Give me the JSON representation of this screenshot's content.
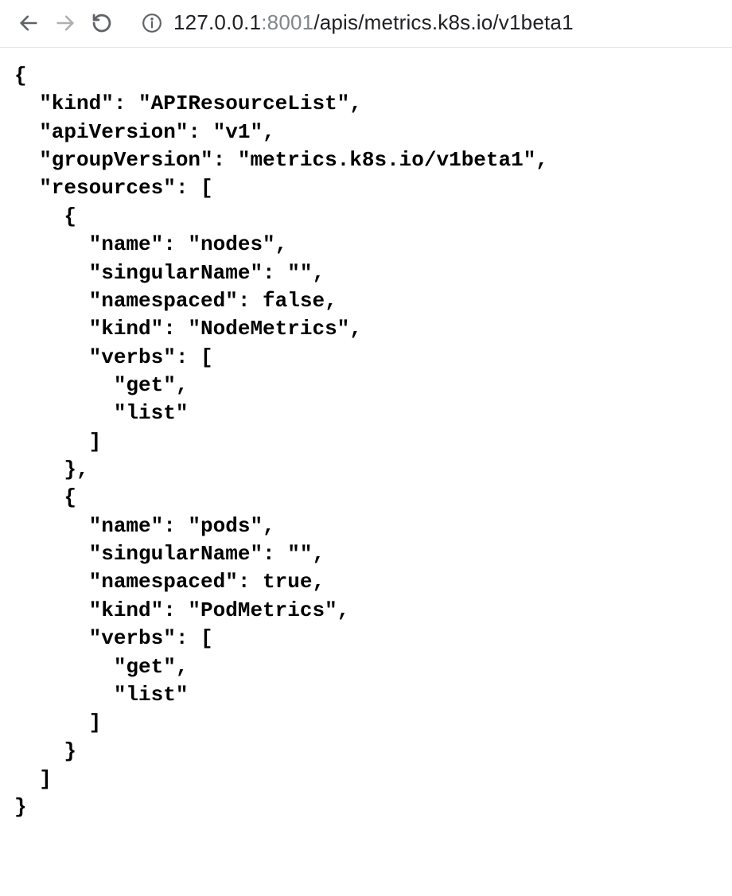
{
  "toolbar": {
    "url_host": "127.0.0.1",
    "url_port": ":8001",
    "url_path": "/apis/metrics.k8s.io/v1beta1"
  },
  "body_json": {
    "kind": "APIResourceList",
    "apiVersion": "v1",
    "groupVersion": "metrics.k8s.io/v1beta1",
    "resources": [
      {
        "name": "nodes",
        "singularName": "",
        "namespaced": false,
        "kind": "NodeMetrics",
        "verbs": [
          "get",
          "list"
        ]
      },
      {
        "name": "pods",
        "singularName": "",
        "namespaced": true,
        "kind": "PodMetrics",
        "verbs": [
          "get",
          "list"
        ]
      }
    ]
  }
}
